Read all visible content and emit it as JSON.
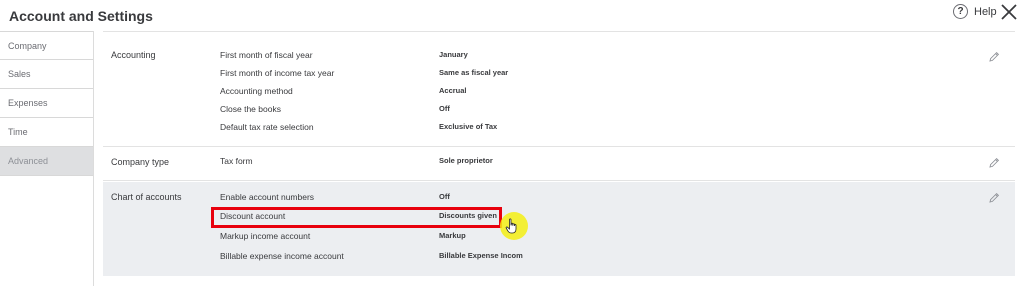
{
  "header": {
    "title": "Account and Settings",
    "help_glyph": "?",
    "help_label": "Help",
    "close_icon": "close-x-icon"
  },
  "sidebar": {
    "items": [
      {
        "label": "Company",
        "active": false
      },
      {
        "label": "Sales",
        "active": false
      },
      {
        "label": "Expenses",
        "active": false
      },
      {
        "label": "Time",
        "active": false
      },
      {
        "label": "Advanced",
        "active": true
      }
    ]
  },
  "sections": {
    "accounting": {
      "label": "Accounting",
      "rows": [
        {
          "label": "First month of fiscal year",
          "value": "January"
        },
        {
          "label": "First month of income tax year",
          "value": "Same as fiscal year"
        },
        {
          "label": "Accounting method",
          "value": "Accrual"
        },
        {
          "label": "Close the books",
          "value": "Off"
        },
        {
          "label": "Default tax rate selection",
          "value": "Exclusive of Tax"
        }
      ]
    },
    "company_type": {
      "label": "Company type",
      "rows": [
        {
          "label": "Tax form",
          "value": "Sole proprietor"
        }
      ]
    },
    "chart_of_accounts": {
      "label": "Chart of accounts",
      "rows": [
        {
          "label": "Enable account numbers",
          "value": "Off"
        },
        {
          "label": "Discount account",
          "value": "Discounts given"
        },
        {
          "label": "Markup income account",
          "value": "Markup"
        },
        {
          "label": "Billable expense income account",
          "value": "Billable Expense Incom"
        }
      ]
    }
  },
  "colors": {
    "highlight": "#e8000d",
    "cursor_halo": "#f5ee14",
    "shaded_section": "#eceef1",
    "active_nav": "#dedfe1"
  },
  "icons": [
    "help-icon",
    "close-icon",
    "pencil-icon",
    "hand-cursor-icon"
  ]
}
